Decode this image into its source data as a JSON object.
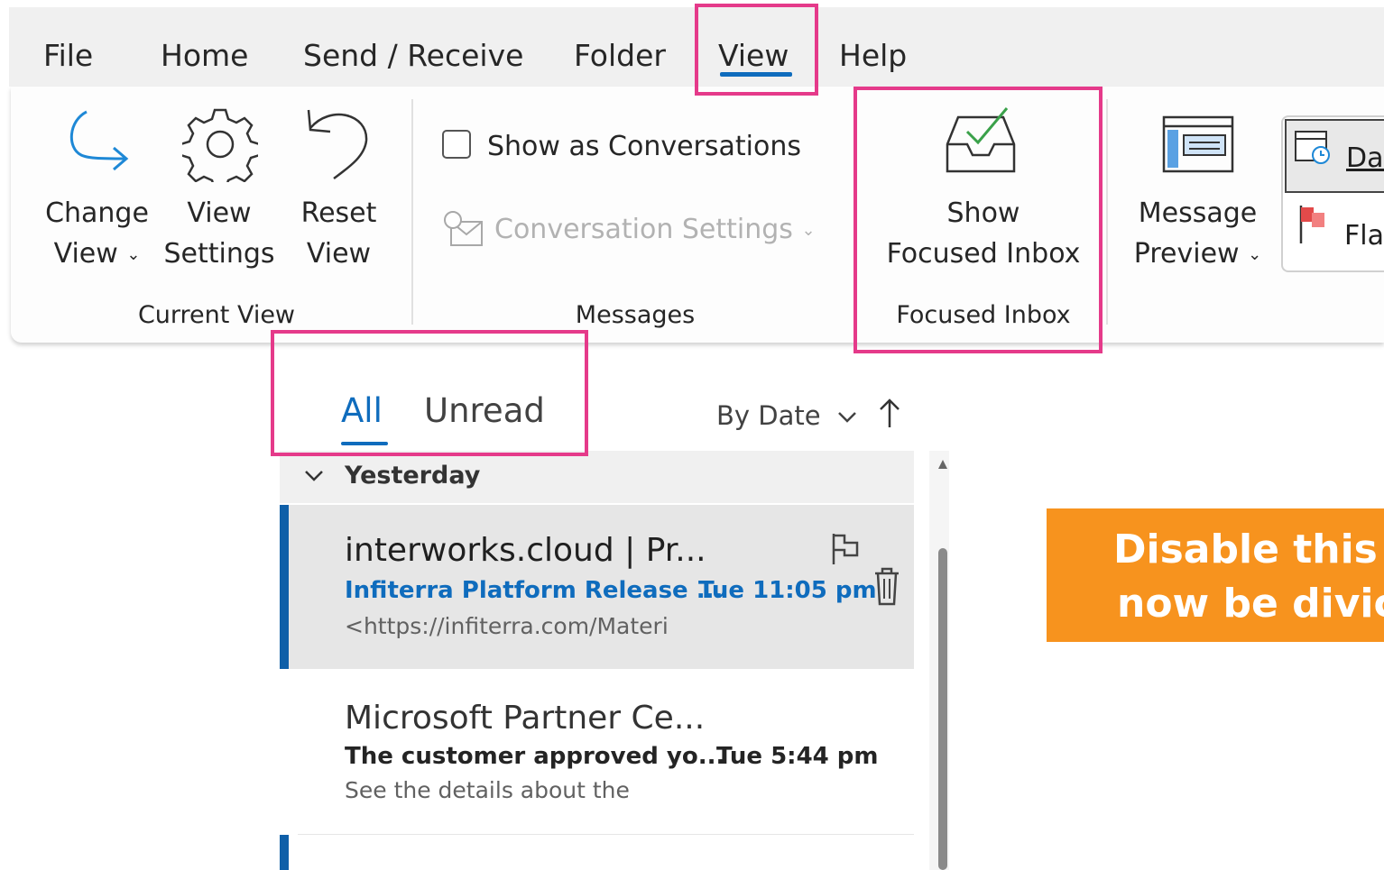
{
  "menu": {
    "tabs": [
      "File",
      "Home",
      "Send / Receive",
      "Folder",
      "View",
      "Help"
    ],
    "active": "View"
  },
  "ribbon": {
    "current_view": {
      "group_label": "Current View",
      "change_view": [
        "Change",
        "View"
      ],
      "view_settings": [
        "View",
        "Settings"
      ],
      "reset_view": [
        "Reset",
        "View"
      ]
    },
    "messages": {
      "group_label": "Messages",
      "show_as_conversations": "Show as Conversations",
      "conversation_settings": "Conversation Settings"
    },
    "focused_inbox": {
      "group_label": "Focused Inbox",
      "button": [
        "Show",
        "Focused Inbox"
      ]
    },
    "layout": {
      "message_preview": [
        "Message",
        "Preview"
      ],
      "date_button": "Dat",
      "flag_button": "Fla"
    }
  },
  "mail_list": {
    "tabs": [
      "All",
      "Unread"
    ],
    "active_tab": "All",
    "sort_label": "By Date",
    "group_header": "Yesterday",
    "items": [
      {
        "subject": "interworks.cloud | Pr...",
        "sender": "Infiterra Platform Release ...",
        "time": "Tue 11:05 pm",
        "preview": "<https://infiterra.com/Materi",
        "unread": true
      },
      {
        "subject": "Microsoft Partner Ce...",
        "sender": "The customer approved yo...",
        "time": "Tue 5:44 pm",
        "preview": "See the details about the",
        "unread": false
      }
    ]
  },
  "callout": {
    "line1": "Disable this v",
    "line2": "now be divic"
  },
  "colors": {
    "accent_blue": "#0f6cbd",
    "highlight_pink": "#e53a8a",
    "callout_orange": "#f7931e",
    "selected_row_bg": "#e6e6e6"
  }
}
